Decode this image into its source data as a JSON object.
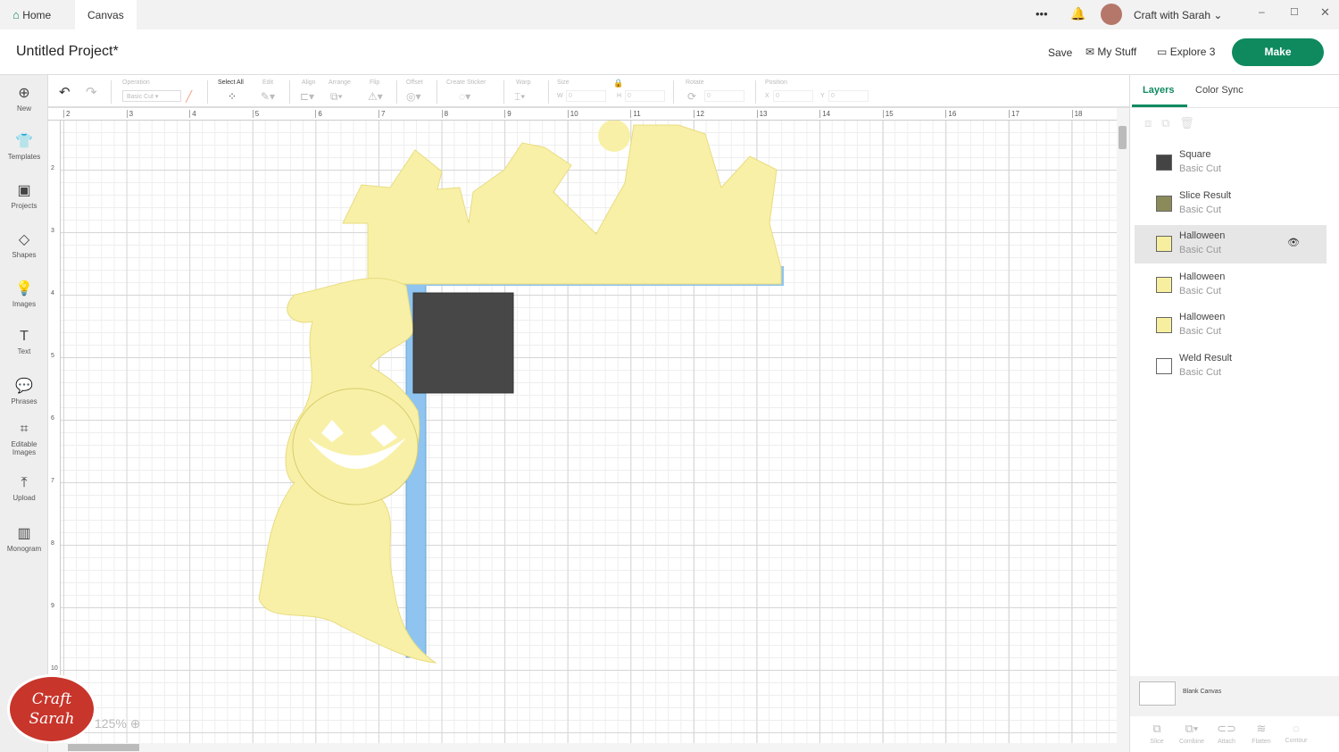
{
  "tabs": {
    "home": "Home",
    "canvas": "Canvas"
  },
  "account": {
    "more": "•••",
    "user": "Craft with Sarah"
  },
  "header": {
    "title": "Untitled Project*",
    "save": "Save",
    "my_stuff": "My Stuff",
    "machine": "Explore 3",
    "make": "Make"
  },
  "sidebar": [
    {
      "label": "New",
      "icon": "⊕"
    },
    {
      "label": "Templates",
      "icon": "👕"
    },
    {
      "label": "Projects",
      "icon": "▣"
    },
    {
      "label": "Shapes",
      "icon": "◇"
    },
    {
      "label": "Images",
      "icon": "💡"
    },
    {
      "label": "Text",
      "icon": "T"
    },
    {
      "label": "Phrases",
      "icon": "💬"
    },
    {
      "label": "Editable Images",
      "icon": "⌗"
    },
    {
      "label": "Upload",
      "icon": "⤒"
    },
    {
      "label": "Monogram",
      "icon": "▥"
    }
  ],
  "toolbar": {
    "operation": "Operation",
    "operation_value": "Basic Cut",
    "select_all": "Select All",
    "edit": "Edit",
    "align": "Align",
    "arrange": "Arrange",
    "flip": "Flip",
    "offset": "Offset",
    "create_sticker": "Create Sticker",
    "warp": "Warp",
    "size": "Size",
    "w": "W",
    "h": "H",
    "rotate": "Rotate",
    "position": "Position",
    "x": "X",
    "y": "Y",
    "zero": "0"
  },
  "ruler": {
    "h": [
      "2",
      "3",
      "4",
      "5",
      "6",
      "7",
      "8",
      "9",
      "10",
      "11",
      "12",
      "13",
      "14",
      "15",
      "16",
      "17",
      "18"
    ],
    "v": [
      "2",
      "3",
      "4",
      "5",
      "6",
      "7",
      "8",
      "9",
      "10"
    ]
  },
  "zoom": "125%",
  "watermark": "Craft with Sarah",
  "panel": {
    "tabs": [
      "Layers",
      "Color Sync"
    ],
    "layers": [
      {
        "name": "Square",
        "op": "Basic Cut",
        "color": "#444444"
      },
      {
        "name": "Slice Result",
        "op": "Basic Cut",
        "color": "#8a8a5a"
      },
      {
        "name": "Halloween",
        "op": "Basic Cut",
        "color": "#f7ef9f",
        "selected": true
      },
      {
        "name": "Halloween",
        "op": "Basic Cut",
        "color": "#f7ef9f"
      },
      {
        "name": "Halloween",
        "op": "Basic Cut",
        "color": "#f7ef9f"
      },
      {
        "name": "Weld Result",
        "op": "Basic Cut",
        "color": "#ffffff"
      }
    ],
    "blank_canvas": "Blank Canvas",
    "actions": [
      "Slice",
      "Combine",
      "Attach",
      "Flatten",
      "Contour"
    ]
  },
  "colors": {
    "accent": "#0f8a5f",
    "yellow": "#f8f0a6",
    "blue": "#8ec4ef",
    "square": "#474747"
  }
}
